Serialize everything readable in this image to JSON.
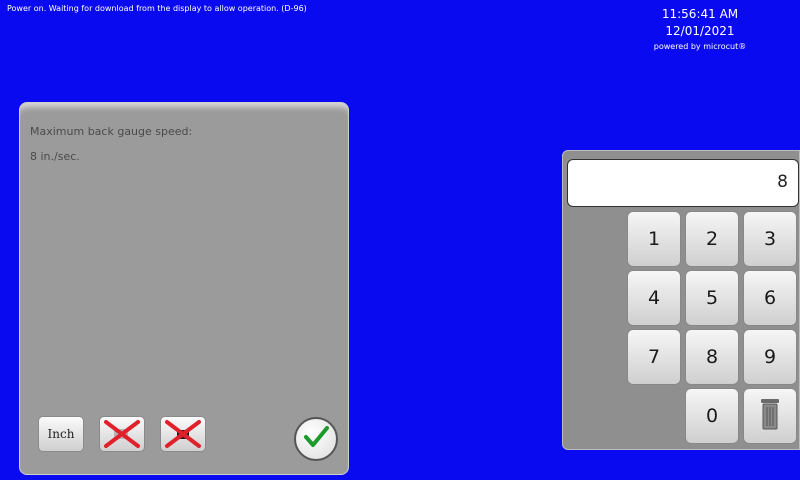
{
  "status_message": "Power on. Waiting for download from the display to allow operation. (D-96)",
  "clock": {
    "time": "11:56:41 AM",
    "date": "12/01/2021",
    "powered_by": "powered by microcut®"
  },
  "info_panel": {
    "title": "Maximum back gauge speed:",
    "value": "8 in./sec.",
    "unit_button_label": "Inch"
  },
  "keypad": {
    "display_value": "8",
    "keys": {
      "k1": "1",
      "k2": "2",
      "k3": "3",
      "k4": "4",
      "k5": "5",
      "k6": "6",
      "k7": "7",
      "k8": "8",
      "k9": "9",
      "k0": "0"
    }
  },
  "colors": {
    "background": "#0a0af0",
    "panel": "#9b9b9b",
    "cancel_red": "#e0202a",
    "ok_green": "#1c9a2a"
  },
  "icons": {
    "cancel": "red-x-icon",
    "delete": "trash-icon",
    "confirm": "check-icon"
  }
}
